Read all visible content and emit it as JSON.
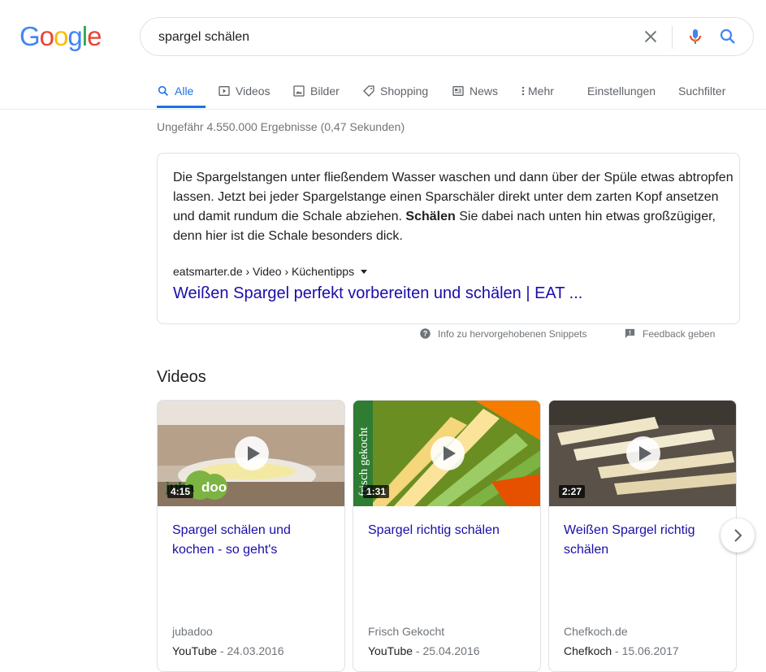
{
  "logo": {
    "text": "Google",
    "letters": [
      "G",
      "o",
      "o",
      "g",
      "l",
      "e"
    ],
    "colors": [
      "#4285F4",
      "#EA4335",
      "#FBBC05",
      "#4285F4",
      "#34A853",
      "#EA4335"
    ]
  },
  "search": {
    "query": "spargel schälen",
    "clear_icon": "close-icon",
    "voice_icon": "microphone-icon",
    "submit_icon": "search-icon"
  },
  "tabs": [
    {
      "label": "Alle",
      "icon": "search-icon",
      "active": true
    },
    {
      "label": "Videos",
      "icon": "video-icon"
    },
    {
      "label": "Bilder",
      "icon": "image-icon"
    },
    {
      "label": "Shopping",
      "icon": "tag-icon"
    },
    {
      "label": "News",
      "icon": "news-icon"
    },
    {
      "label": "Mehr",
      "icon": "more-vert-icon"
    },
    {
      "label": "Einstellungen"
    },
    {
      "label": "Suchfilter"
    }
  ],
  "stats": "Ungefähr 4.550.000 Ergebnisse (0,47 Sekunden)",
  "snippet": {
    "text_before": "Die Spargelstangen unter fließendem Wasser waschen und dann über der Spüle etwas abtropfen lassen. Jetzt bei jeder Spargelstange einen Sparschäler direkt unter dem zarten Kopf ansetzen und damit rundum die Schale abziehen. ",
    "text_bold": "Schälen",
    "text_after": " Sie dabei nach unten hin etwas großzügiger, denn hier ist die Schale besonders dick.",
    "cite": "eatsmarter.de › Video › Küchentipps",
    "title": "Weißen Spargel perfekt vorbereiten und schälen | EAT ...",
    "info_label": "Info zu hervorgehobenen Snippets",
    "feedback_label": "Feedback geben"
  },
  "videos": {
    "heading": "Videos",
    "items": [
      {
        "duration": "4:15",
        "title_line1": "Spargel schälen und",
        "title_line2": "kochen - so geht's",
        "source": "jubadoo",
        "platform": "YouTube",
        "date": " - 24.03.2016",
        "overlay": "jubadoo"
      },
      {
        "duration": "1:31",
        "title_line1": "Spargel richtig schälen",
        "title_line2": "",
        "source": "Frisch Gekocht",
        "platform": "YouTube",
        "date": " - 25.04.2016",
        "overlay": "frisch gekocht"
      },
      {
        "duration": "2:27",
        "title_line1": "Weißen Spargel richtig",
        "title_line2": "schälen",
        "source": "Chefkoch.de",
        "platform": "Chefkoch",
        "date": " - 15.06.2017"
      }
    ],
    "next_icon": "chevron-right-icon"
  }
}
